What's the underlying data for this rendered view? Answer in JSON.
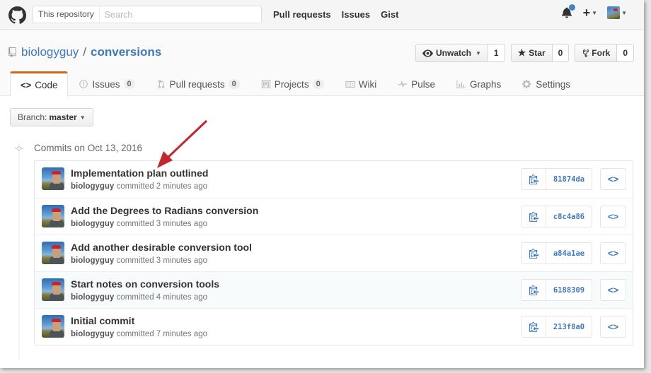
{
  "header": {
    "search_scope": "This repository",
    "search_placeholder": "Search",
    "nav": [
      "Pull requests",
      "Issues",
      "Gist"
    ],
    "notification_color": "#4183c4"
  },
  "repo": {
    "owner": "biologyguy",
    "separator": "/",
    "name": "conversions",
    "actions": {
      "watch": {
        "label": "Unwatch",
        "count": "1"
      },
      "star": {
        "label": "Star",
        "count": "0"
      },
      "fork": {
        "label": "Fork",
        "count": "0"
      }
    },
    "tabs": [
      {
        "label": "Code",
        "icon": "code-icon",
        "selected": true
      },
      {
        "label": "Issues",
        "count": "0",
        "icon": "issue-icon"
      },
      {
        "label": "Pull requests",
        "count": "0",
        "icon": "pull-request-icon"
      },
      {
        "label": "Projects",
        "count": "0",
        "icon": "project-icon"
      },
      {
        "label": "Wiki",
        "icon": "book-icon"
      },
      {
        "label": "Pulse",
        "icon": "pulse-icon"
      },
      {
        "label": "Graphs",
        "icon": "graph-icon"
      },
      {
        "label": "Settings",
        "icon": "gear-icon"
      }
    ],
    "accent_color": "#d26911"
  },
  "branch": {
    "prefix": "Branch:",
    "name": "master"
  },
  "commits": {
    "date_heading": "Commits on Oct 13, 2016",
    "items": [
      {
        "message": "Implementation plan outlined",
        "author": "biologyguy",
        "verb": "committed",
        "time": "2 minutes ago",
        "sha": "81874da"
      },
      {
        "message": "Add the Degrees to Radians conversion",
        "author": "biologyguy",
        "verb": "committed",
        "time": "3 minutes ago",
        "sha": "c8c4a86"
      },
      {
        "message": "Add another desirable conversion tool",
        "author": "biologyguy",
        "verb": "committed",
        "time": "3 minutes ago",
        "sha": "a84a1ae"
      },
      {
        "message": "Start notes on conversion tools",
        "author": "biologyguy",
        "verb": "committed",
        "time": "4 minutes ago",
        "sha": "6188309"
      },
      {
        "message": "Initial commit",
        "author": "biologyguy",
        "verb": "committed",
        "time": "7 minutes ago",
        "sha": "213f8a0"
      }
    ],
    "browse_label": "<>"
  },
  "annotation": {
    "arrow_color": "#c1272d"
  }
}
